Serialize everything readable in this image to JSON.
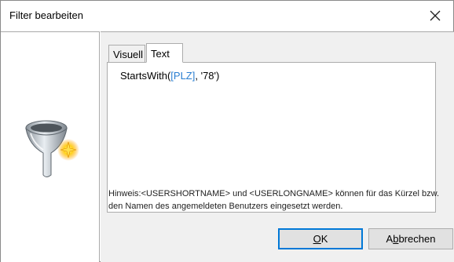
{
  "window": {
    "title": "Filter bearbeiten"
  },
  "icons": {
    "close": "close-icon",
    "funnel": "funnel-icon"
  },
  "tabs": [
    {
      "label": "Visuell",
      "active": false
    },
    {
      "label": "Text",
      "active": true
    }
  ],
  "editor": {
    "function": "StartsWith(",
    "field": "[PLZ]",
    "rest": ", '78')"
  },
  "hint": "Hinweis:<USERSHORTNAME> und <USERLONGNAME> können für das Kürzel bzw. den Namen des angemeldeten Benutzers eingesetzt werden.",
  "buttons": {
    "ok_accel": "O",
    "ok_rest": "K",
    "cancel_prefix": "A",
    "cancel_accel": "b",
    "cancel_rest": "brechen"
  },
  "colors": {
    "field_token": "#2b7fd1",
    "ok_focus_border": "#0078d7"
  }
}
